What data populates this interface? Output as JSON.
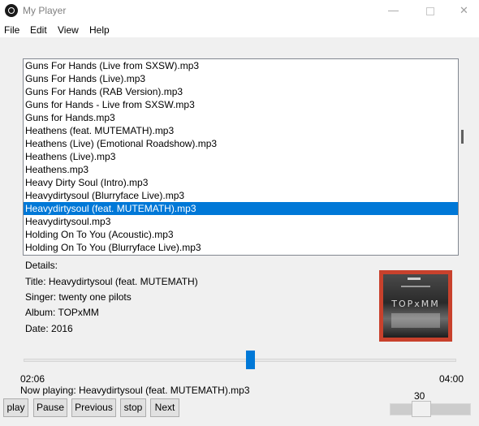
{
  "window": {
    "title": "My Player",
    "minimize_glyph": "—",
    "close_glyph": "✕"
  },
  "menu": {
    "items": [
      "File",
      "Edit",
      "View",
      "Help"
    ]
  },
  "playlist": {
    "items": [
      "Guns For Hands (Live from SXSW).mp3",
      "Guns For Hands (Live).mp3",
      "Guns For Hands (RAB Version).mp3",
      "Guns for Hands - Live from SXSW.mp3",
      "Guns for Hands.mp3",
      "Heathens (feat. MUTEMATH).mp3",
      "Heathens (Live) (Emotional Roadshow).mp3",
      "Heathens (Live).mp3",
      "Heathens.mp3",
      "Heavy Dirty Soul (Intro).mp3",
      "Heavydirtysoul (Blurryface Live).mp3",
      "Heavydirtysoul (feat. MUTEMATH).mp3",
      "Heavydirtysoul.mp3",
      "Holding On To You (Acoustic).mp3",
      "Holding On To You (Blurryface Live).mp3"
    ],
    "selected_index": 11
  },
  "details": {
    "heading": "Details:",
    "title_line": "Title: Heavydirtysoul (feat. MUTEMATH)",
    "singer_line": "Singer: twenty one pilots",
    "album_line": "Album: TOPxMM",
    "date_line": "Date: 2016"
  },
  "album_art": {
    "text": "TOPxMM",
    "border_color": "#c8412c"
  },
  "playback": {
    "elapsed": "02:06",
    "total": "04:00",
    "progress": 0.525,
    "now_playing": "Now playing:  Heavydirtysoul (feat. MUTEMATH).mp3"
  },
  "controls": {
    "play_label": "play",
    "pause_label": "Pause",
    "previous_label": "Previous",
    "stop_label": "stop",
    "next_label": "Next"
  },
  "volume": {
    "value": "30"
  },
  "colors": {
    "accent": "#0078d7"
  }
}
